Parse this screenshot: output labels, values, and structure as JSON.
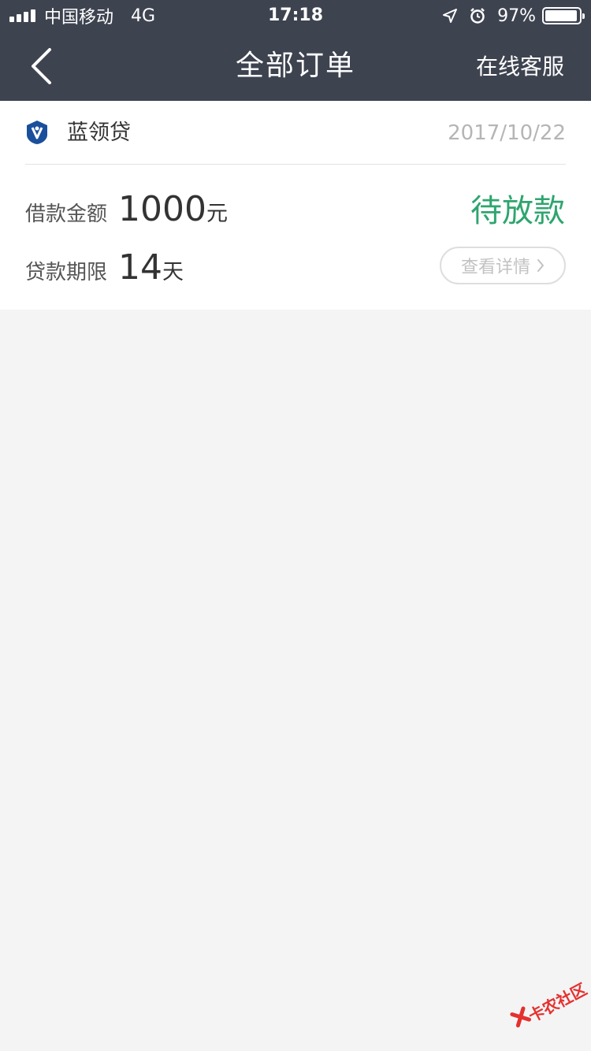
{
  "status_bar": {
    "carrier": "中国移动",
    "network": "4G",
    "time": "17:18",
    "battery": "97%",
    "battery_level": 0.97
  },
  "nav": {
    "title": "全部订单",
    "service_label": "在线客服"
  },
  "order": {
    "brand": "蓝领贷",
    "date": "2017/10/22",
    "amount_label": "借款金额",
    "amount_value": "1000",
    "amount_unit": "元",
    "term_label": "贷款期限",
    "term_value": "14",
    "term_unit": "天",
    "status": "待放款",
    "detail_label": "查看详情"
  },
  "watermark": {
    "text": "卡农社区"
  },
  "colors": {
    "header_bg": "#3e4350",
    "status_green": "#2ea56e",
    "brand_blue": "#1a4f9c",
    "page_bg": "#f4f4f5"
  },
  "icons": {
    "back": "chevron-left-icon",
    "location": "location-arrow-icon",
    "alarm": "alarm-clock-icon",
    "detail_chevron": "chevron-right-icon",
    "brand": "brand-logo-icon"
  }
}
